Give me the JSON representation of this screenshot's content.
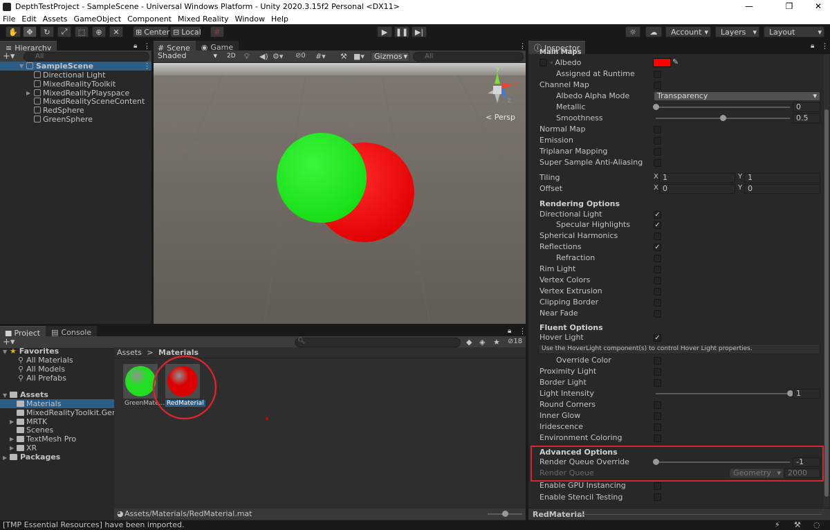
{
  "window": {
    "title": "DepthTestProject - SampleScene - Universal Windows Platform - Unity 2020.3.15f2 Personal <DX11>",
    "minimize": "—",
    "restore": "❐",
    "close": "✕"
  },
  "menu": [
    "File",
    "Edit",
    "Assets",
    "GameObject",
    "Component",
    "Mixed Reality",
    "Window",
    "Help"
  ],
  "toolbar": {
    "pivot": "Center",
    "space": "Local",
    "account": "Account",
    "layers": "Layers",
    "layout": "Layout"
  },
  "hierarchy": {
    "tab": "Hierarchy",
    "search_placeholder": "All",
    "scene": "SampleScene",
    "items": [
      {
        "label": "Directional Light",
        "expandable": false
      },
      {
        "label": "MixedRealityToolkit",
        "expandable": false
      },
      {
        "label": "MixedRealityPlayspace",
        "expandable": true
      },
      {
        "label": "MixedRealitySceneContent",
        "expandable": false
      },
      {
        "label": "RedSphere",
        "expandable": false
      },
      {
        "label": "GreenSphere",
        "expandable": false
      }
    ]
  },
  "scene": {
    "tab_scene": "Scene",
    "tab_game": "Game",
    "shading": "Shaded",
    "mode_2d": "2D",
    "hidden_count": "0",
    "gizmos": "Gizmos",
    "search_placeholder": "All",
    "persp": "Persp",
    "gizmo_x": "x",
    "gizmo_y": "y",
    "gizmo_z": "z",
    "colors": {
      "red": "#ff1010",
      "green": "#22ee22",
      "floor": "#6e6761",
      "sky": "#c9c9c9"
    }
  },
  "project": {
    "tab_project": "Project",
    "tab_console": "Console",
    "hidden_count": "18",
    "favorites": "Favorites",
    "favorites_items": [
      "All Materials",
      "All Models",
      "All Prefabs"
    ],
    "assets": "Assets",
    "asset_folders": [
      {
        "label": "Materials",
        "selected": true,
        "expandable": false
      },
      {
        "label": "MixedRealityToolkit.Generated",
        "selected": false,
        "expandable": false
      },
      {
        "label": "MRTK",
        "selected": false,
        "expandable": true
      },
      {
        "label": "Scenes",
        "selected": false,
        "expandable": false
      },
      {
        "label": "TextMesh Pro",
        "selected": false,
        "expandable": true
      },
      {
        "label": "XR",
        "selected": false,
        "expandable": true
      }
    ],
    "packages": "Packages",
    "breadcrumb_root": "Assets",
    "breadcrumb_current": "Materials",
    "assets_grid": [
      {
        "label": "GreenMate...",
        "color": "#22dd22"
      },
      {
        "label": "RedMaterial",
        "color": "#dd0000"
      }
    ],
    "footer_path": "Assets/Materials/RedMaterial.mat"
  },
  "inspector": {
    "tab": "Inspector",
    "top_header": "Main Maps",
    "rows_main": [
      {
        "label": "Albedo",
        "indent": false,
        "control": "color"
      },
      {
        "label": "Assigned at Runtime",
        "indent": true,
        "control": "check",
        "checked": false
      },
      {
        "label": "Channel Map",
        "indent": false,
        "control": "check",
        "checked": false
      },
      {
        "label": "Albedo Alpha Mode",
        "indent": true,
        "control": "dropdown",
        "value": "Transparency"
      },
      {
        "label": "Metallic",
        "indent": true,
        "control": "slider",
        "value": "0",
        "fraction": 0
      },
      {
        "label": "Smoothness",
        "indent": true,
        "control": "slider",
        "value": "0.5",
        "fraction": 0.5
      },
      {
        "label": "Normal Map",
        "indent": false,
        "control": "check",
        "checked": false
      },
      {
        "label": "Emission",
        "indent": false,
        "control": "check",
        "checked": false
      },
      {
        "label": "Triplanar Mapping",
        "indent": false,
        "control": "check",
        "checked": false
      },
      {
        "label": "Super Sample Anti-Aliasing",
        "indent": false,
        "control": "check",
        "checked": false
      }
    ],
    "tiling_label": "Tiling",
    "offset_label": "Offset",
    "tiling": {
      "x": "1",
      "y": "1"
    },
    "offset": {
      "x": "0",
      "y": "0"
    },
    "axis_x": "X",
    "axis_y": "Y",
    "albedo_color": "#ff0000",
    "rendering_header": "Rendering Options",
    "rendering_rows": [
      {
        "label": "Directional Light",
        "indent": false,
        "checked": true
      },
      {
        "label": "Specular Highlights",
        "indent": true,
        "checked": true
      },
      {
        "label": "Spherical Harmonics",
        "indent": false,
        "checked": false
      },
      {
        "label": "Reflections",
        "indent": false,
        "checked": true
      },
      {
        "label": "Refraction",
        "indent": true,
        "checked": false
      },
      {
        "label": "Rim Light",
        "indent": false,
        "checked": false
      },
      {
        "label": "Vertex Colors",
        "indent": false,
        "checked": false
      },
      {
        "label": "Vertex Extrusion",
        "indent": false,
        "checked": false
      },
      {
        "label": "Clipping Border",
        "indent": false,
        "checked": false
      },
      {
        "label": "Near Fade",
        "indent": false,
        "checked": false
      }
    ],
    "fluent_header": "Fluent Options",
    "hover_light": "Hover Light",
    "hover_note": "Use the HoverLight component(s) to control Hover Light properties.",
    "fluent_rows": [
      {
        "label": "Override Color",
        "indent": true,
        "control": "check",
        "checked": false
      },
      {
        "label": "Proximity Light",
        "indent": false,
        "control": "check",
        "checked": false
      },
      {
        "label": "Border Light",
        "indent": false,
        "control": "check",
        "checked": false
      },
      {
        "label": "Light Intensity",
        "indent": false,
        "control": "slider",
        "value": "1",
        "fraction": 1
      },
      {
        "label": "Round Corners",
        "indent": false,
        "control": "check",
        "checked": false
      },
      {
        "label": "Inner Glow",
        "indent": false,
        "control": "check",
        "checked": false
      },
      {
        "label": "Iridescence",
        "indent": false,
        "control": "check",
        "checked": false
      },
      {
        "label": "Environment Coloring",
        "indent": false,
        "control": "check",
        "checked": false
      }
    ],
    "advanced_header": "Advanced Options",
    "render_queue_override": "Render Queue Override",
    "render_queue_override_value": "-1",
    "render_queue": "Render Queue",
    "render_queue_mode": "Geometry",
    "render_queue_value": "2000",
    "gpu_instancing": "Enable GPU Instancing",
    "stencil_testing": "Enable Stencil Testing",
    "footer": "RedMaterial",
    "highlight_color": "#d9252f"
  },
  "status": "[TMP Essential Resources] have been imported."
}
